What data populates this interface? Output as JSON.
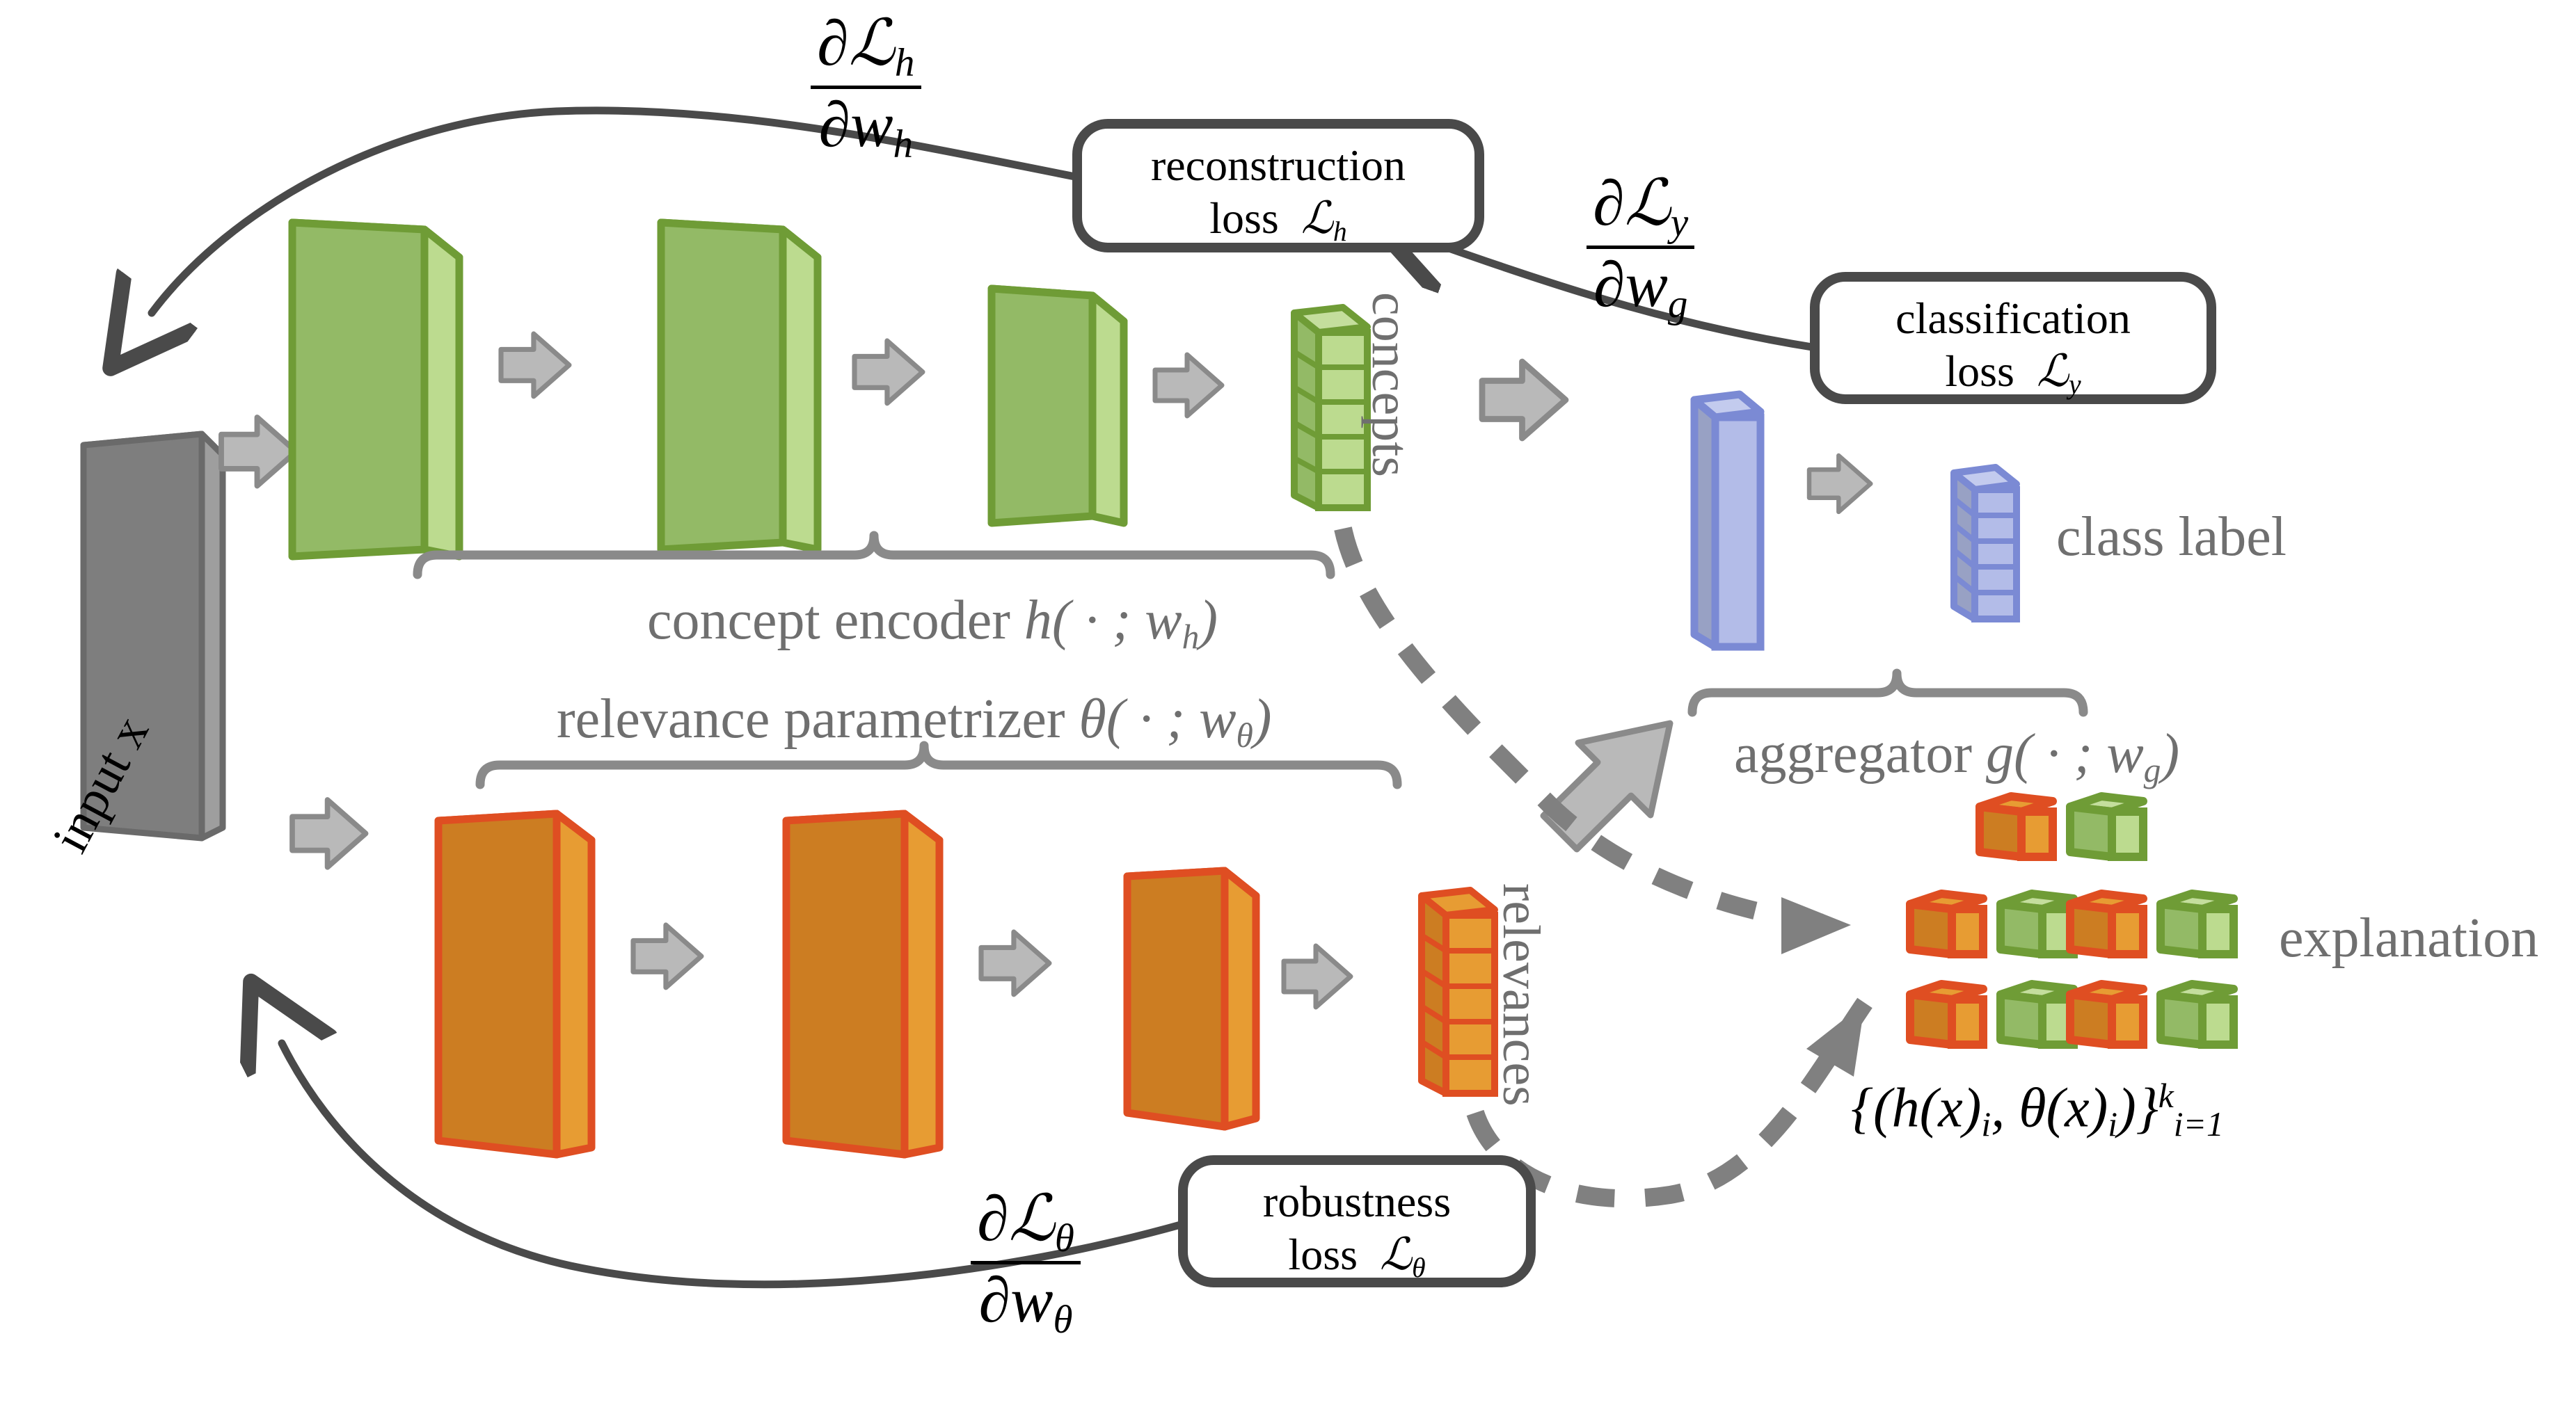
{
  "diagram": {
    "title": "Self-Explaining Neural Network (SENN) architecture",
    "background": "#ffffff"
  },
  "colors": {
    "green_border": "#6f9c36",
    "green_face": "#8fb860",
    "green_light": "#bcdb8f",
    "orange_border": "#df4e22",
    "orange_face": "#cc7d22",
    "orange_light": "#e79c33",
    "blue_border": "#7b8ad4",
    "blue_face": "#b3bce8",
    "blue_side": "#98a1c4",
    "gray_arrow": "#b4b4b4",
    "gray_stroke": "#7f7f7f",
    "gray_text": "#6f6f6f",
    "dark_stroke": "#4a4a4a",
    "input_face": "#7c7c7c",
    "input_edge": "#a8a8a8",
    "black": "#000000"
  },
  "labels": {
    "input": "input x",
    "concepts": "concepts",
    "relevances": "relevances",
    "class_label": "class label",
    "explanation": "explanation",
    "concept_encoder": "concept encoder",
    "concept_encoder_fn": "h( · ; w",
    "concept_encoder_sub": "h",
    "relevance_parametrizer": "relevance parametrizer",
    "relevance_parametrizer_fn": "θ( · ; w",
    "relevance_parametrizer_sub": "θ",
    "aggregator": "aggregator",
    "aggregator_fn": "g( · ; w",
    "aggregator_sub": "g"
  },
  "loss_boxes": [
    {
      "id": "reconstruction",
      "line1": "reconstruction",
      "line2_pre": "loss",
      "line2_symbol": "ℒ",
      "line2_sub": "h"
    },
    {
      "id": "classification",
      "line1": "classification",
      "line2_pre": "loss",
      "line2_symbol": "ℒ",
      "line2_sub": "y"
    },
    {
      "id": "robustness",
      "line1": "robustness",
      "line2_pre": "loss",
      "line2_symbol": "ℒ",
      "line2_sub": "θ"
    }
  ],
  "gradients": [
    {
      "id": "grad_h",
      "numerator_partial": "∂",
      "numerator_symbol": "ℒ",
      "numerator_sub": "h",
      "denominator_partial": "∂",
      "denominator_symbol": "w",
      "denominator_sub": "h"
    },
    {
      "id": "grad_y",
      "numerator_partial": "∂",
      "numerator_symbol": "ℒ",
      "numerator_sub": "y",
      "denominator_partial": "∂",
      "denominator_symbol": "w",
      "denominator_sub": "g"
    },
    {
      "id": "grad_theta",
      "numerator_partial": "∂",
      "numerator_symbol": "ℒ",
      "numerator_sub": "θ",
      "denominator_partial": "∂",
      "denominator_symbol": "w",
      "denominator_sub": "θ"
    }
  ],
  "explanation_formula": {
    "open": "{(h(x)",
    "sub_i_1": "i",
    "mid": ", θ(x)",
    "sub_i_2": "i",
    "close": ")}",
    "sup_k": "k",
    "sub_i1": "i=1",
    "full_text": "{(h(x)ᵢ, θ(x)ᵢ)}ᵏᵢ₌₁"
  },
  "structure": {
    "concept_encoder_layers": 3,
    "relevance_parametrizer_layers": 3,
    "concepts_cells": 5,
    "relevances_cells": 5,
    "class_label_cells": 5,
    "explanation_pairs": 5
  }
}
